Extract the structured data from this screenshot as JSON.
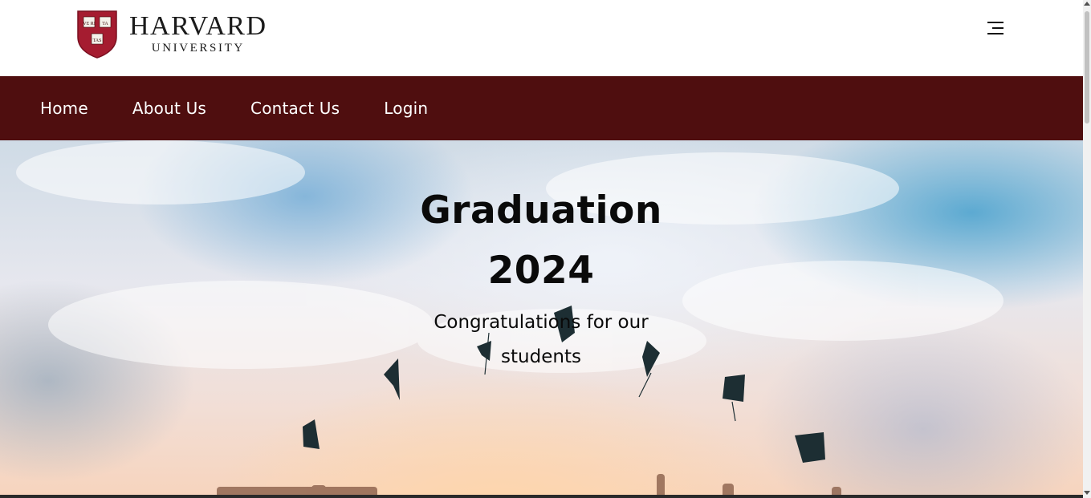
{
  "header": {
    "logo_word_1": "HARVARD",
    "logo_word_2": "UNIVERSITY",
    "shield_icon": "harvard-shield-icon",
    "menu_icon": "hamburger-menu-icon"
  },
  "nav": {
    "items": [
      {
        "label": "Home"
      },
      {
        "label": "About Us"
      },
      {
        "label": "Contact Us"
      },
      {
        "label": "Login"
      }
    ]
  },
  "hero": {
    "title_line_1": "Graduation",
    "title_line_2": "2024",
    "subtitle": "Congratulations for our students"
  },
  "colors": {
    "nav_bg": "#4f0e0f",
    "crimson": "#a51c30",
    "text_dark": "#0a0a0a"
  }
}
